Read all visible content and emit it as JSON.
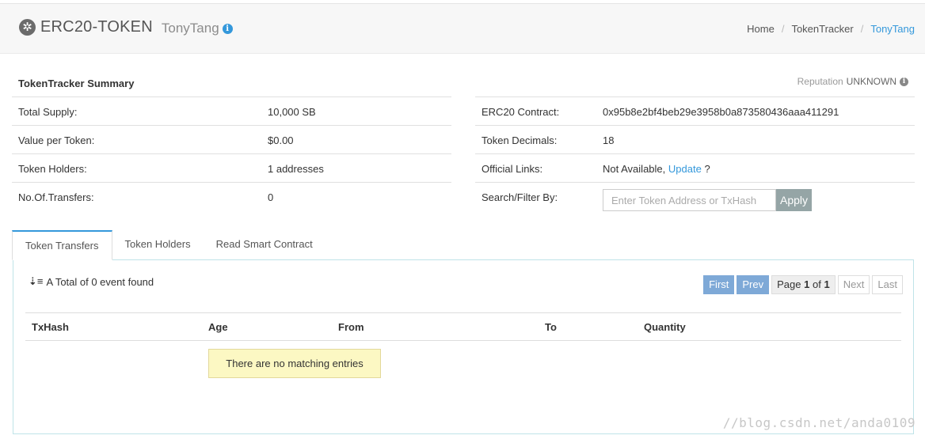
{
  "header": {
    "token_icon": "token-gear-icon",
    "token_name": "ERC20-TOKEN",
    "token_sub": "TonyTang",
    "breadcrumb": [
      "Home",
      "TokenTracker",
      "TonyTang"
    ]
  },
  "summary": {
    "title": "TokenTracker Summary",
    "reputation_label": "Reputation",
    "reputation_value": "UNKNOWN",
    "left": [
      {
        "label": "Total Supply:",
        "value": "10,000 SB"
      },
      {
        "label": "Value per Token:",
        "value": "$0.00"
      },
      {
        "label": "Token Holders:",
        "value": "1 addresses"
      },
      {
        "label": "No.Of.Transfers:",
        "value": "0"
      }
    ],
    "right": {
      "contract_label": "ERC20 Contract:",
      "contract_value": "0x95b8e2bf4beb29e3958b0a873580436aaa411291",
      "decimals_label": "Token Decimals:",
      "decimals_value": "18",
      "links_label": "Official Links:",
      "links_value": "Not Available,",
      "links_update": "Update",
      "links_suffix": "?",
      "search_label": "Search/Filter By:",
      "search_placeholder": "Enter Token Address or TxHash",
      "apply_label": "Apply"
    }
  },
  "tabs": [
    "Token Transfers",
    "Token Holders",
    "Read Smart Contract"
  ],
  "transfers": {
    "event_count": "A Total of 0 event found",
    "pager": {
      "first": "First",
      "prev": "Prev",
      "page_prefix": "Page",
      "page_current": "1",
      "page_of": "of",
      "page_total": "1",
      "next": "Next",
      "last": "Last"
    },
    "columns": [
      "TxHash",
      "Age",
      "From",
      "To",
      "Quantity"
    ],
    "empty_message": "There are no matching entries"
  },
  "watermark": "//blog.csdn.net/anda0109",
  "colors": {
    "accent": "#3498db",
    "pager_blue": "#7ea9d7",
    "apply_gray": "#95a5a6",
    "empty_bg": "#fcf8c3"
  }
}
